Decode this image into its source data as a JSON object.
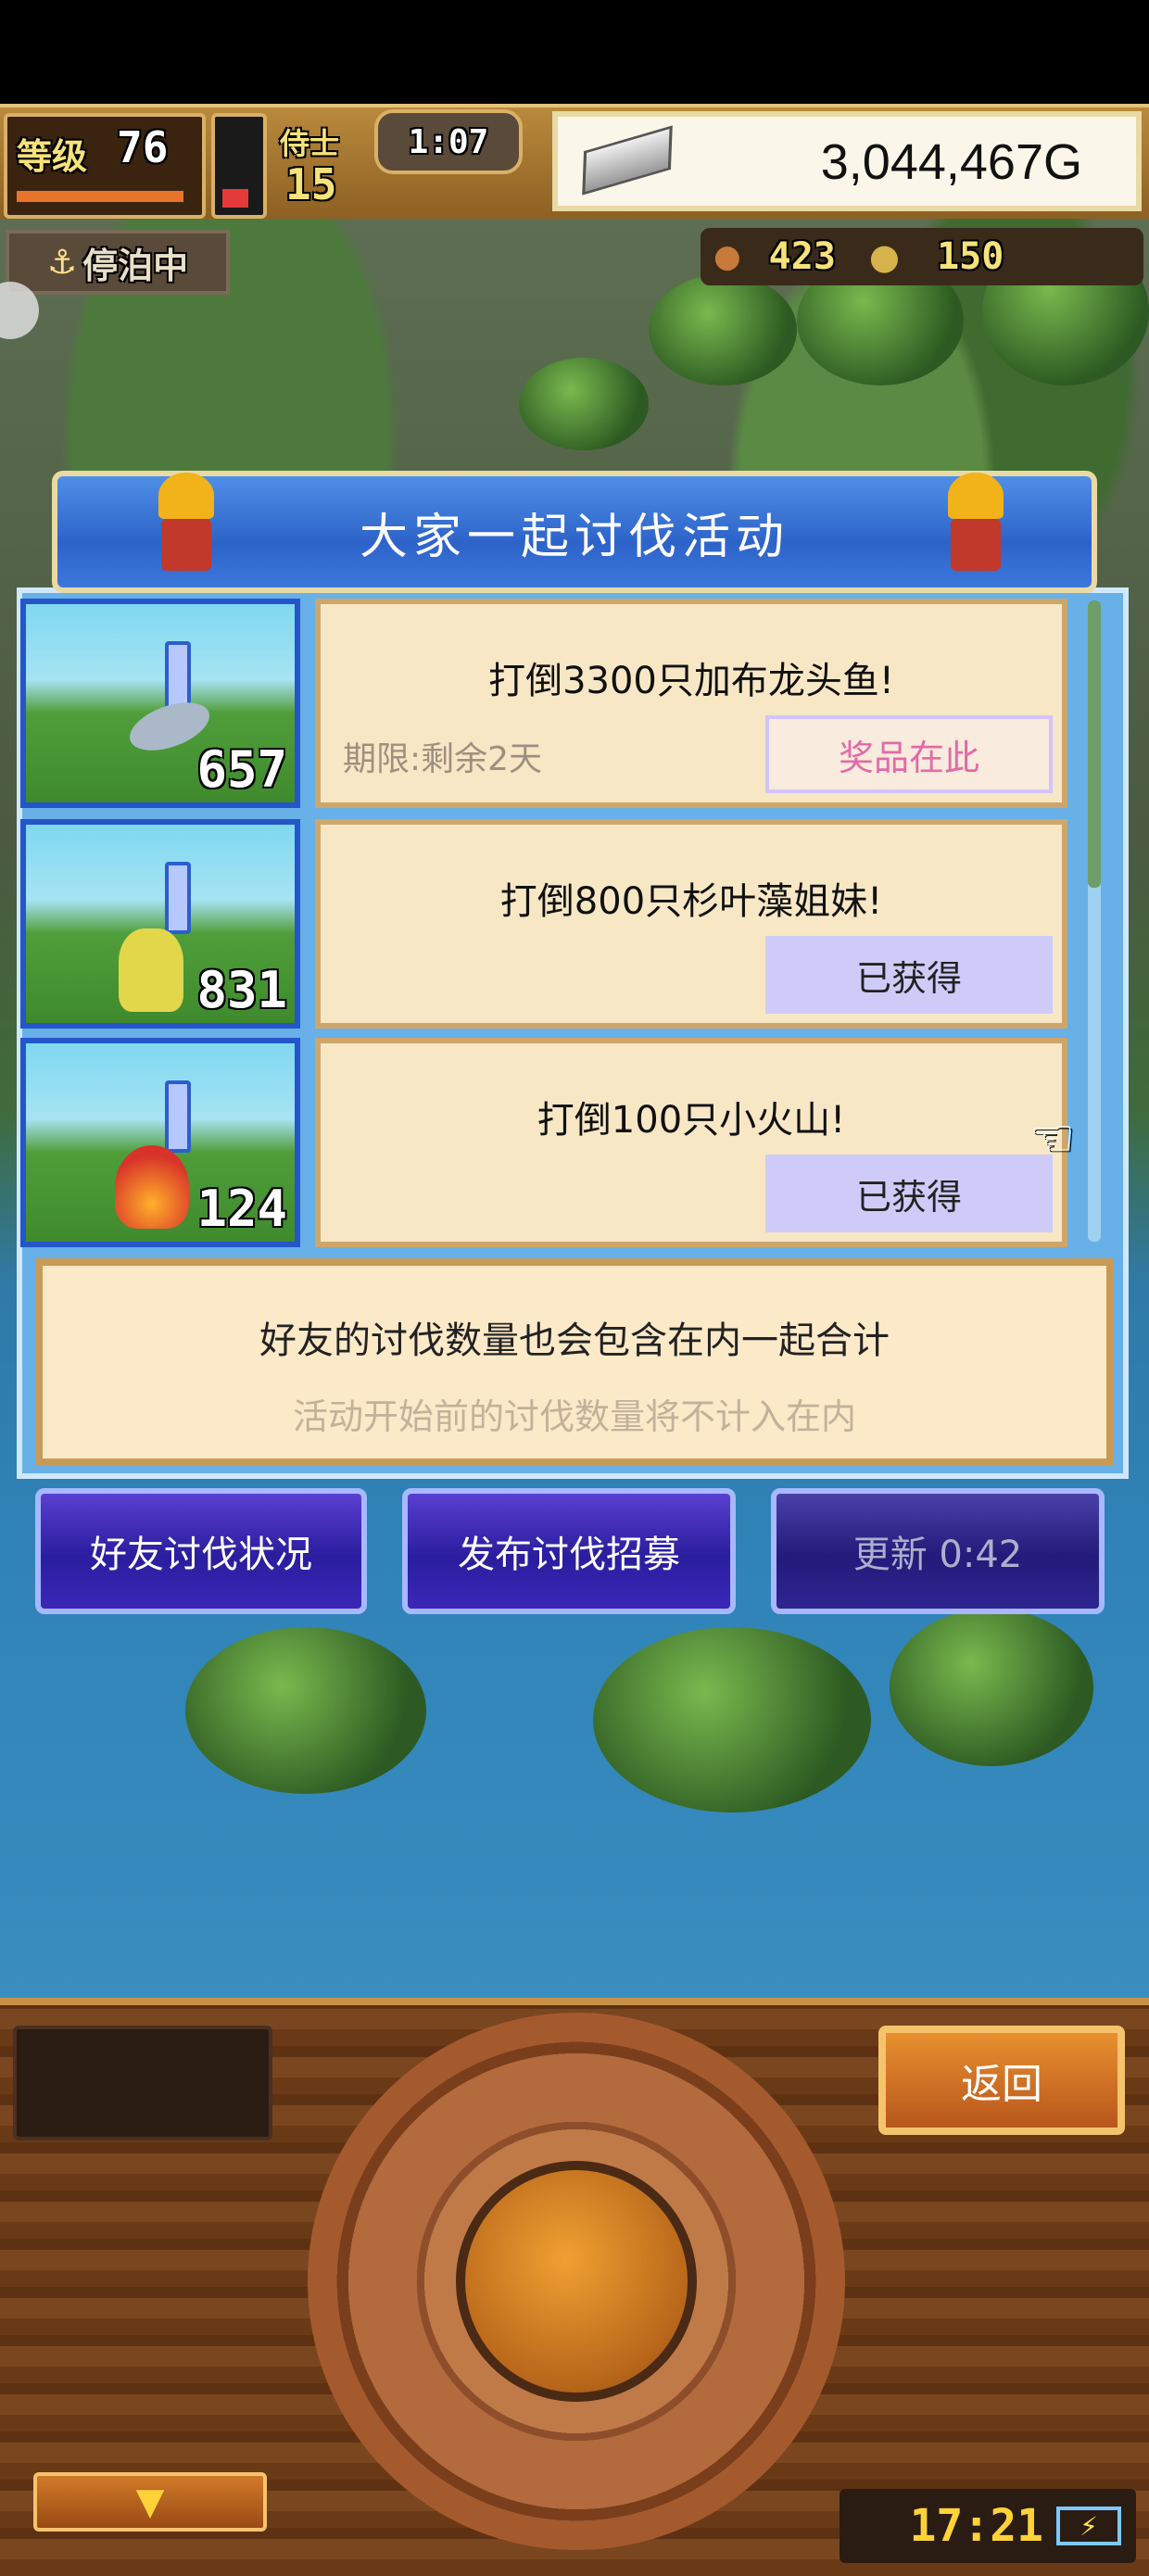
{
  "hud": {
    "level_label": "等级",
    "level_value": "76",
    "staff_label": "侍士",
    "staff_value": "15",
    "timer": "1:07",
    "gold": "3,044,467G",
    "status": "停泊中",
    "food": "423",
    "medals": "150"
  },
  "dialog": {
    "title": "大家一起讨伐活动",
    "events": [
      {
        "count": "657",
        "goal": "打倒3300只加布龙头鱼!",
        "limit": "期限:剩余2天",
        "button": "奖品在此",
        "state": "available"
      },
      {
        "count": "831",
        "goal": "打倒800只杉叶藻姐妹!",
        "limit": "",
        "button": "已获得",
        "state": "claimed"
      },
      {
        "count": "124",
        "goal": "打倒100只小火山!",
        "limit": "",
        "button": "已获得",
        "state": "claimed"
      }
    ],
    "info_line1": "好友的讨伐数量也会包含在内一起合计",
    "info_line2": "活动开始前的讨伐数量将不计入在内"
  },
  "buttons": {
    "friends_status": "好友讨伐状况",
    "post_recruit": "发布讨伐招募",
    "refresh": "更新 0:42",
    "back": "返回"
  },
  "footer": {
    "clock": "17:21"
  },
  "colors": {
    "title_blue": "#2d63c9",
    "card_beige": "#f7e7c5",
    "prize_pink": "#e36aa8",
    "claimed_purple": "#cfcbf8"
  }
}
